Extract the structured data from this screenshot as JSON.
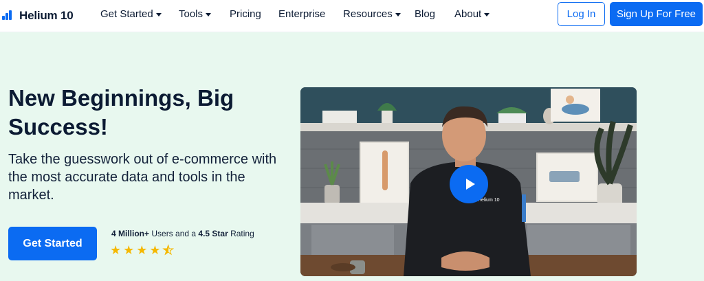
{
  "brand": {
    "name": "Helium 10"
  },
  "nav": {
    "items": [
      {
        "label": "Get Started",
        "dropdown": true
      },
      {
        "label": "Tools",
        "dropdown": true
      },
      {
        "label": "Pricing",
        "dropdown": false
      },
      {
        "label": "Enterprise",
        "dropdown": false
      },
      {
        "label": "Resources",
        "dropdown": true
      },
      {
        "label": "Blog",
        "dropdown": false
      },
      {
        "label": "About",
        "dropdown": true
      }
    ],
    "login_label": "Log In",
    "signup_label": "Sign Up For Free"
  },
  "hero": {
    "title": "New Beginnings, Big Success!",
    "subtitle": "Take the guesswork out of e-commerce with the most accurate data and tools in the market.",
    "cta_label": "Get Started",
    "users_count": "4 Million+",
    "users_text": " Users and a ",
    "rating_value": "4.5 Star",
    "rating_text": " Rating",
    "rating": 4.5
  },
  "video": {
    "play_icon": "play-icon"
  },
  "colors": {
    "accent": "#0b6bf2",
    "hero_bg": "#e8f8ef",
    "star": "#f5b800"
  }
}
